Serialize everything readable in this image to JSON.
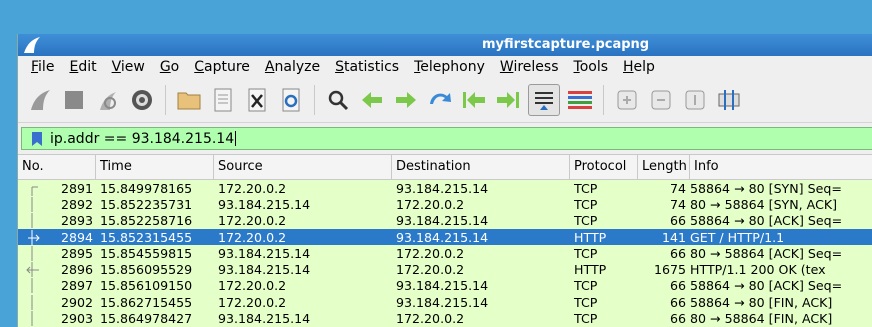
{
  "window": {
    "title": "myfirstcapture.pcapng"
  },
  "menu": [
    "File",
    "Edit",
    "View",
    "Go",
    "Capture",
    "Analyze",
    "Statistics",
    "Telephony",
    "Wireless",
    "Tools",
    "Help"
  ],
  "toolbar": {
    "icons": [
      "shark-fin-start-icon",
      "stop-square-icon",
      "restart-icon",
      "gear-options-icon",
      "open-folder-icon",
      "file-icon",
      "close-file-icon",
      "reload-icon",
      "magnifier-find-icon",
      "go-back-icon",
      "go-forward-icon",
      "jump-to-icon",
      "go-first-icon",
      "go-last-icon",
      "autoscroll-icon",
      "colorize-icon",
      "zoom-in-icon",
      "zoom-out-icon",
      "normal-size-icon",
      "resize-columns-icon"
    ]
  },
  "filter": {
    "value": "ip.addr == 93.184.215.14"
  },
  "columns": [
    "No.",
    "Time",
    "Source",
    "Destination",
    "Protocol",
    "Length",
    "Info"
  ],
  "rows": [
    {
      "no": "2891",
      "time": "15.849978165",
      "src": "172.20.0.2",
      "dst": "93.184.215.14",
      "proto": "TCP",
      "len": "74",
      "info": "58864 → 80 [SYN] Seq="
    },
    {
      "no": "2892",
      "time": "15.852235731",
      "src": "93.184.215.14",
      "dst": "172.20.0.2",
      "proto": "TCP",
      "len": "74",
      "info": "80 → 58864 [SYN, ACK]"
    },
    {
      "no": "2893",
      "time": "15.852258716",
      "src": "172.20.0.2",
      "dst": "93.184.215.14",
      "proto": "TCP",
      "len": "66",
      "info": "58864 → 80 [ACK] Seq="
    },
    {
      "no": "2894",
      "time": "15.852315455",
      "src": "172.20.0.2",
      "dst": "93.184.215.14",
      "proto": "HTTP",
      "len": "141",
      "info": "GET / HTTP/1.1"
    },
    {
      "no": "2895",
      "time": "15.854559815",
      "src": "93.184.215.14",
      "dst": "172.20.0.2",
      "proto": "TCP",
      "len": "66",
      "info": "80 → 58864 [ACK] Seq="
    },
    {
      "no": "2896",
      "time": "15.856095529",
      "src": "93.184.215.14",
      "dst": "172.20.0.2",
      "proto": "HTTP",
      "len": "1675",
      "info": "HTTP/1.1 200 OK  (tex"
    },
    {
      "no": "2897",
      "time": "15.856109150",
      "src": "172.20.0.2",
      "dst": "93.184.215.14",
      "proto": "TCP",
      "len": "66",
      "info": "58864 → 80 [ACK] Seq="
    },
    {
      "no": "2902",
      "time": "15.862715455",
      "src": "172.20.0.2",
      "dst": "93.184.215.14",
      "proto": "TCP",
      "len": "66",
      "info": "58864 → 80 [FIN, ACK]"
    },
    {
      "no": "2903",
      "time": "15.864978427",
      "src": "93.184.215.14",
      "dst": "172.20.0.2",
      "proto": "TCP",
      "len": "66",
      "info": "80 → 58864 [FIN, ACK]"
    }
  ],
  "colors": {
    "row_bg": "#e4ffc7",
    "selected_bg": "#2a7ac9",
    "filter_bg": "#afffaf",
    "titlebar": "#3585d0"
  }
}
